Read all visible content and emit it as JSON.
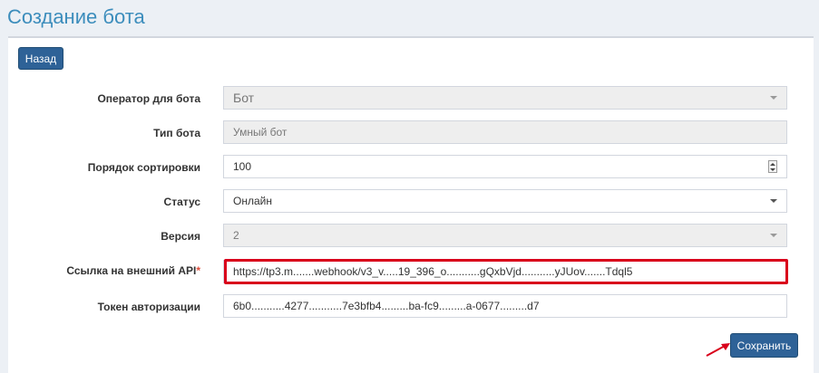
{
  "page": {
    "title": "Создание бота"
  },
  "buttons": {
    "back_label": "Назад",
    "save_label": "Сохранить"
  },
  "form": {
    "operator": {
      "label": "Оператор для бота",
      "value": "Бот"
    },
    "bot_type": {
      "label": "Тип бота",
      "value": "Умный бот"
    },
    "sort_order": {
      "label": "Порядок сортировки",
      "value": "100"
    },
    "status": {
      "label": "Статус",
      "value": "Онлайн"
    },
    "version": {
      "label": "Версия",
      "value": "2"
    },
    "api_url": {
      "label": "Ссылка на внешний API",
      "required_mark": "*",
      "value": "https://tp3.m.......webhook/v3_v.....19_396_o...........gQxbVjd...........yJUov.......Tdql5"
    },
    "auth_token": {
      "label": "Токен авторизации",
      "value": "6b0...........4277...........7e3bfb4.........ba-fc9.........a-0677.........d7"
    }
  },
  "colors": {
    "accent": "#3c8dbc",
    "button": "#2e6297",
    "highlight": "#d9001b"
  }
}
